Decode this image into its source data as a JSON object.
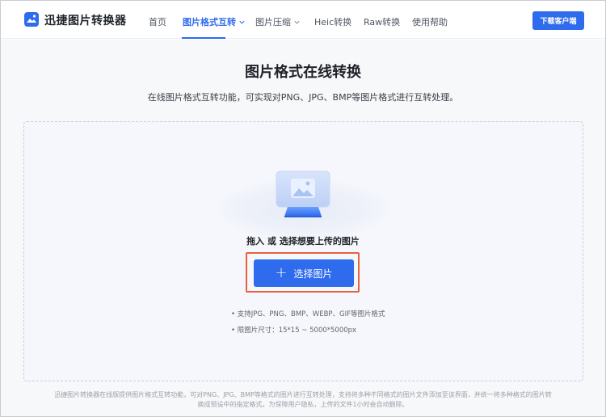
{
  "header": {
    "brand": "迅捷图片转换器",
    "nav": [
      {
        "label": "首页",
        "active": false,
        "dropdown": false
      },
      {
        "label": "图片格式互转",
        "active": true,
        "dropdown": true
      },
      {
        "label": "图片压缩",
        "active": false,
        "dropdown": true
      },
      {
        "label": "Heic转换",
        "active": false,
        "dropdown": false
      },
      {
        "label": "Raw转换",
        "active": false,
        "dropdown": false
      },
      {
        "label": "使用帮助",
        "active": false,
        "dropdown": false
      }
    ],
    "download_button": "下载客户端"
  },
  "main": {
    "title": "图片格式在线转换",
    "subtitle": "在线图片格式互转功能，可实现对PNG、JPG、BMP等图片格式进行互转处理。",
    "drop_hint": "拖入 或 选择想要上传的图片",
    "select_button": "选择图片",
    "requirements": [
      "• 支持JPG、PNG、BMP、WEBP、GIF等图片格式",
      "• 限图片尺寸：15*15 ~ 5000*5000px"
    ]
  },
  "footer": {
    "line1": "迅捷图片转换器在线版提供图片格式互转功能，可对PNG、JPG、BMP等格式的图片进行互转处理，支持将多种不同格式的图片文件添加至该界面，并统一将多种格式的图片转",
    "line2": "换成预设中的指定格式。为保障用户隐私，上传的文件1小时会自动删除。"
  },
  "colors": {
    "accent": "#2f6bed",
    "highlight": "#e8613a"
  }
}
